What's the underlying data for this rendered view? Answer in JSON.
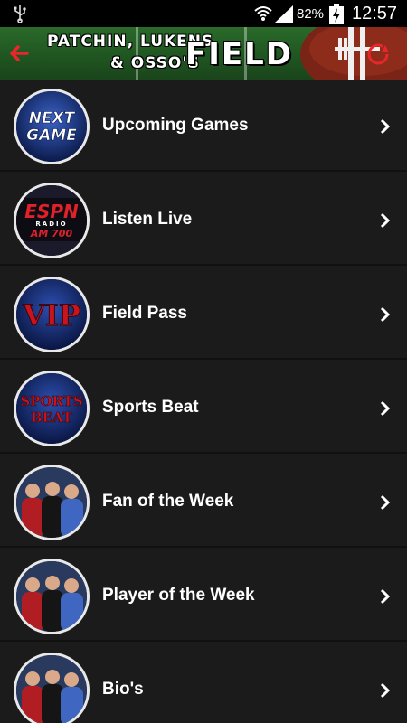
{
  "status_bar": {
    "battery_percent": "82%",
    "time": "12:57",
    "icons": [
      "usb-icon",
      "wifi-icon",
      "signal-icon",
      "battery-charging-icon"
    ]
  },
  "header": {
    "line1": "PATCHIN, LUKENS",
    "line2": "& OSSO'S",
    "title": "FIELD PASS",
    "back_icon": "back-arrow-icon",
    "refresh_icon": "refresh-icon",
    "accent_color": "#e8262b"
  },
  "menu": {
    "items": [
      {
        "label": "Upcoming Games",
        "icon": "next-game-icon",
        "icon_text": [
          "NEXT",
          "GAME"
        ]
      },
      {
        "label": "Listen Live",
        "icon": "espn-radio-icon",
        "icon_text": [
          "ESPN",
          "RADIO",
          "AM 700"
        ]
      },
      {
        "label": "Field Pass",
        "icon": "vip-icon",
        "icon_text": [
          "VIP"
        ]
      },
      {
        "label": "Sports Beat",
        "icon": "sports-beat-icon",
        "icon_text": [
          "SPORTS",
          "BEAT"
        ]
      },
      {
        "label": "Fan of the Week",
        "icon": "hosts-photo-icon"
      },
      {
        "label": "Player of the Week",
        "icon": "hosts-photo-icon"
      },
      {
        "label": "Bio's",
        "icon": "hosts-photo-icon"
      }
    ]
  }
}
